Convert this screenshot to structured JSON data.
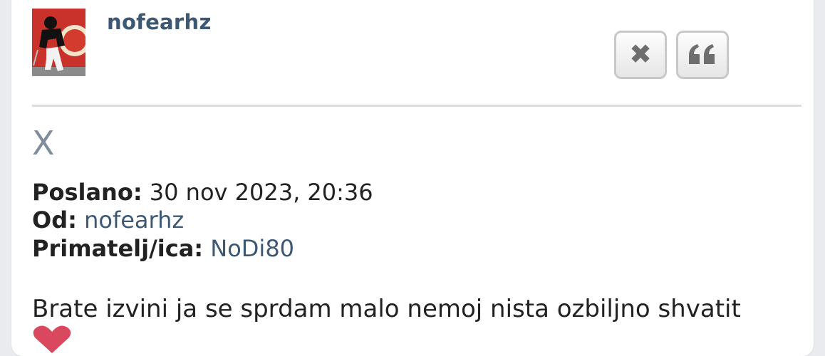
{
  "post": {
    "username": "nofearhz",
    "subject": "X",
    "labels": {
      "sent": "Poslano:",
      "from": "Od:",
      "recipient": "Primatelj/ica:"
    },
    "sent_value": "30 nov 2023, 20:36",
    "from_value": "nofearhz",
    "recipient_value": "NoDi80",
    "body_line1": "Brate izvini ja se sprdam malo nemoj nista ozbiljno shvatit"
  },
  "actions": {
    "delete_icon": "close-icon",
    "quote_icon": "quote-icon"
  },
  "colors": {
    "username": "#3d5873",
    "link": "#3d5873",
    "subject": "#7e8c9b",
    "heart": "#d9485f"
  }
}
